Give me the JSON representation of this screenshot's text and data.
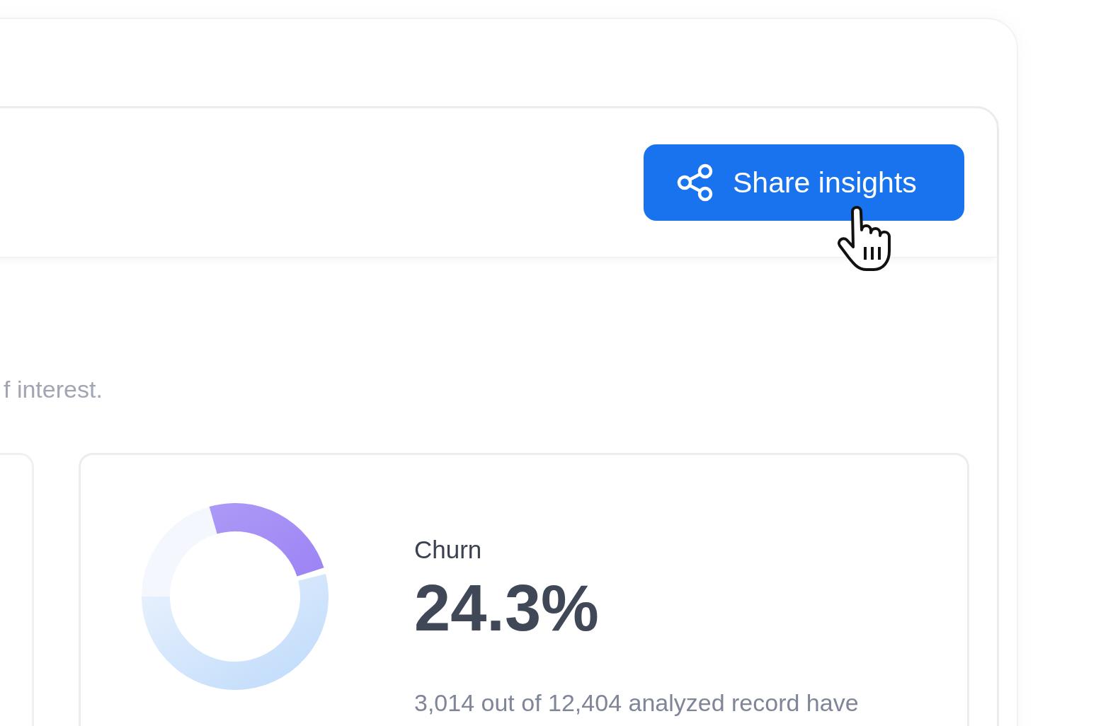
{
  "header": {
    "share_button": {
      "label": "Share insights"
    }
  },
  "description": "f interest.",
  "metric_card": {
    "label": "Churn",
    "value": "24.3%",
    "note": "3,014 out of 12,404 analyzed record have"
  }
}
